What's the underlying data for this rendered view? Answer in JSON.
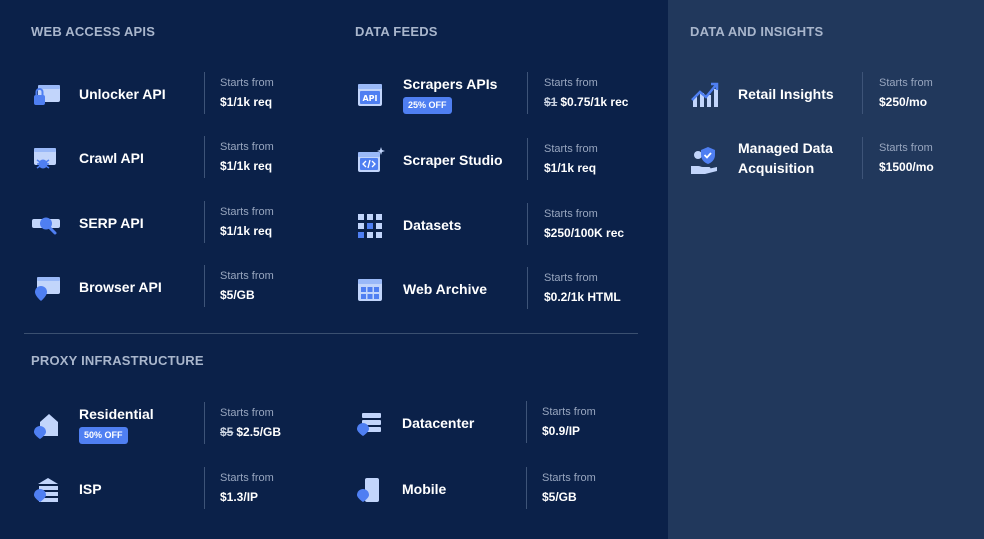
{
  "colors": {
    "background": "#0b2149",
    "right_panel": "#21385c",
    "accent": "#4f7ff2",
    "icon": "#7ea6f7"
  },
  "sections": {
    "web_access": {
      "title": "WEB ACCESS APIS",
      "items": [
        {
          "name": "Unlocker API",
          "starts": "Starts from",
          "price": "$1/1k req",
          "icon": "lock-window-icon"
        },
        {
          "name": "Crawl API",
          "starts": "Starts from",
          "price": "$1/1k req",
          "icon": "spider-window-icon"
        },
        {
          "name": "SERP API",
          "starts": "Starts from",
          "price": "$1/1k req",
          "icon": "magnifier-icon"
        },
        {
          "name": "Browser API",
          "starts": "Starts from",
          "price": "$5/GB",
          "icon": "browser-pin-icon"
        }
      ]
    },
    "data_feeds": {
      "title": "DATA FEEDS",
      "items": [
        {
          "name": "Scrapers APIs",
          "badge": "25% OFF",
          "starts": "Starts from",
          "price_old": "$1",
          "price": "$0.75/1k rec",
          "icon": "api-window-icon"
        },
        {
          "name": "Scraper Studio",
          "starts": "Starts from",
          "price": "$1/1k req",
          "icon": "code-window-icon"
        },
        {
          "name": "Datasets",
          "starts": "Starts from",
          "price": "$250/100K rec",
          "icon": "grid-icon"
        },
        {
          "name": "Web Archive",
          "starts": "Starts from",
          "price": "$0.2/1k HTML",
          "icon": "archive-window-icon"
        }
      ]
    },
    "insights": {
      "title": "DATA AND INSIGHTS",
      "items": [
        {
          "name": "Retail Insights",
          "starts": "Starts from",
          "price": "$250/mo",
          "icon": "chart-growth-icon"
        },
        {
          "name_line1": "Managed Data",
          "name_line2": "Acquisition",
          "starts": "Starts from",
          "price": "$1500/mo",
          "icon": "hand-shield-icon"
        }
      ]
    },
    "proxy": {
      "title": "PROXY INFRASTRUCTURE",
      "items": [
        {
          "name": "Residential",
          "badge": "50% OFF",
          "starts": "Starts from",
          "price_old": "$5",
          "price": "$2.5/GB",
          "icon": "house-pin-icon"
        },
        {
          "name": "Datacenter",
          "starts": "Starts from",
          "price": "$0.9/IP",
          "icon": "server-pin-icon"
        },
        {
          "name": "ISP",
          "starts": "Starts from",
          "price": "$1.3/IP",
          "icon": "stack-pin-icon"
        },
        {
          "name": "Mobile",
          "starts": "Starts from",
          "price": "$5/GB",
          "icon": "phone-pin-icon"
        }
      ]
    }
  }
}
